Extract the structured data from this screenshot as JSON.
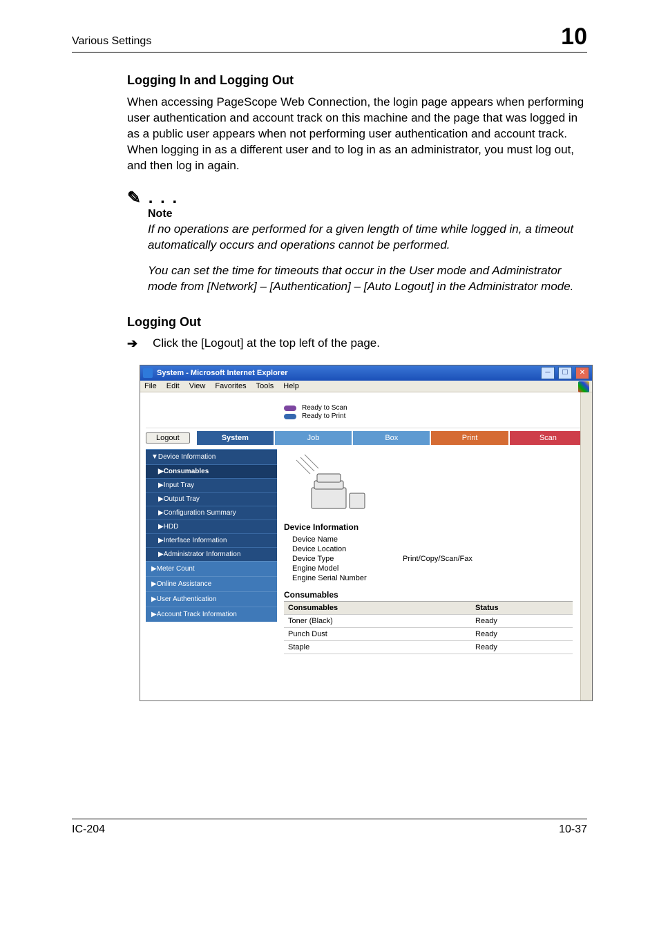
{
  "header": {
    "left": "Various Settings",
    "right": "10"
  },
  "section1": {
    "title": "Logging In and Logging Out",
    "para": "When accessing PageScope Web Connection, the login page appears when performing user authentication and account track on this machine and the page that was logged in as a public user appears when not performing user authentication and account track. When logging in as a different user and to log in as an administrator, you must log out, and then log in again."
  },
  "note": {
    "label": "Note",
    "p1": "If no operations are performed for a given length of time while logged in, a timeout automatically occurs and operations cannot be performed.",
    "p2": "You can set the time for timeouts that occur in the User mode and Administrator mode from [Network] – [Authentication] – [Auto Logout] in the Administrator mode."
  },
  "section2": {
    "title": "Logging Out",
    "step": "Click the [Logout] at the top left of the page."
  },
  "screenshot": {
    "title": "System - Microsoft Internet Explorer",
    "menus": [
      "File",
      "Edit",
      "View",
      "Favorites",
      "Tools",
      "Help"
    ],
    "banner": {
      "scan": "Ready to Scan",
      "print": "Ready to Print"
    },
    "logout": "Logout",
    "tabs": {
      "system": "System",
      "job": "Job",
      "box": "Box",
      "print": "Print",
      "scan": "Scan"
    },
    "sidebar": {
      "device_info": "▼Device Information",
      "subs": [
        "▶Consumables",
        "▶Input Tray",
        "▶Output Tray",
        "▶Configuration Summary",
        "▶HDD",
        "▶Interface Information",
        "▶Administrator Information"
      ],
      "items": [
        "▶Meter Count",
        "▶Online Assistance",
        "▶User Authentication",
        "▶Account Track Information"
      ]
    },
    "main": {
      "info_head": "Device Information",
      "rows": {
        "name_k": "Device Name",
        "name_v": "",
        "loc_k": "Device Location",
        "loc_v": "",
        "type_k": "Device Type",
        "type_v": "Print/Copy/Scan/Fax",
        "model_k": "Engine Model",
        "model_v": "",
        "serial_k": "Engine Serial Number",
        "serial_v": ""
      },
      "cons_head": "Consumables",
      "cons_th1": "Consumables",
      "cons_th2": "Status",
      "cons": [
        {
          "n": "Toner (Black)",
          "s": "Ready"
        },
        {
          "n": "Punch Dust",
          "s": "Ready"
        },
        {
          "n": "Staple",
          "s": "Ready"
        }
      ]
    }
  },
  "footer": {
    "left": "IC-204",
    "right": "10-37"
  }
}
